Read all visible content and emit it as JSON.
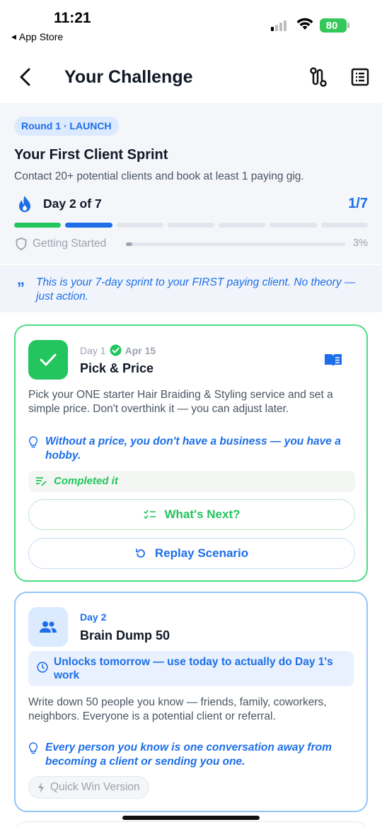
{
  "status_bar": {
    "time": "11:21",
    "back_app": "App Store",
    "battery": "80"
  },
  "header": {
    "title": "Your Challenge",
    "back_icon": "chevron-left-icon",
    "route_icon": "route-icon",
    "list_icon": "list-icon"
  },
  "challenge": {
    "round_badge": "Round 1 · LAUNCH",
    "title": "Your First Client Sprint",
    "description": "Contact 20+ potential clients and book at least 1 paying gig.",
    "day_label": "Day 2 of 7",
    "day_fraction": "1/7",
    "segments": [
      "done",
      "current",
      "upcoming",
      "upcoming",
      "upcoming",
      "upcoming",
      "upcoming"
    ],
    "stage_label": "Getting Started",
    "stage_percent": "3%",
    "stage_progress": 0.03
  },
  "quote": {
    "mark": "”",
    "text": "This is your 7-day sprint to your FIRST paying client. No theory — just action."
  },
  "days": [
    {
      "day": "Day 1",
      "date": "Apr 15",
      "title": "Pick & Price",
      "body": "Pick your ONE starter Hair Braiding & Styling service and set a simple price. Don't overthink it — you can adjust later.",
      "tip": "Without a price, you don't have a business — you have a hobby.",
      "completed_text": "Completed it",
      "whats_next_label": "What's Next?",
      "replay_label": "Replay Scenario"
    },
    {
      "day": "Day 2",
      "title": "Brain Dump 50",
      "lock_note": "Unlocks tomorrow — use today to actually do Day 1's work",
      "body": "Write down 50 people you know — friends, family, coworkers, neighbors. Everyone is a potential client or referral.",
      "tip": "Every person you know is one conversation away from becoming a client or sending you one.",
      "quick_win_label": "Quick Win Version"
    }
  ],
  "colors": {
    "accent_blue": "#1d6ee8",
    "success_green": "#22c55e",
    "muted_gray": "#9ca3af"
  }
}
